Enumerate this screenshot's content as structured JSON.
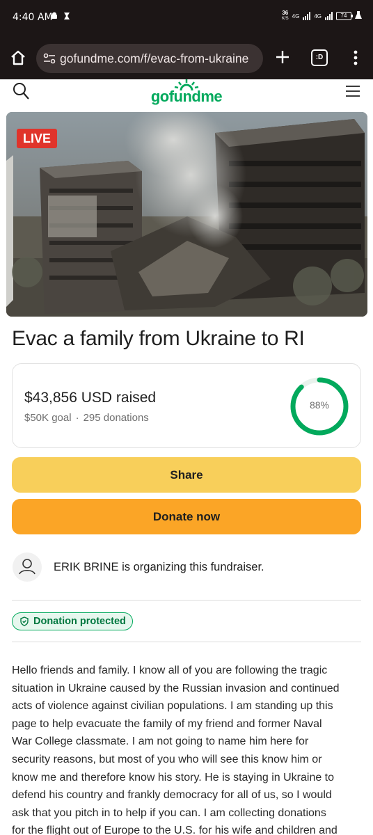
{
  "status_bar": {
    "time": "4:40 AM",
    "net_speed": "36",
    "net_unit": "K/S",
    "sig1": "4G",
    "sig2": "4G",
    "battery": "74"
  },
  "browser": {
    "url": "gofundme.com/f/evac-from-ukraine",
    "tabs_label": ":D"
  },
  "site": {
    "logo_text": "gofundme",
    "brand_color": "#02a95c"
  },
  "hero": {
    "badge": "LIVE"
  },
  "campaign": {
    "title": "Evac a family from Ukraine to RI",
    "raised_text": "$43,856 USD raised",
    "goal_text": "$50K goal",
    "separator": "·",
    "donations_text": "295 donations",
    "progress_percent": 88,
    "progress_label": "88%"
  },
  "actions": {
    "share_label": "Share",
    "donate_label": "Donate now"
  },
  "organizer": {
    "text": "ERIK BRINE is organizing this fundraiser."
  },
  "badge": {
    "protected_label": "Donation protected"
  },
  "story": {
    "lines": [
      "Hello friends and family. I know all of you are following the tragic",
      "situation in Ukraine caused by the Russian invasion and continued",
      "acts of violence against civilian populations. I am standing up this",
      "page to help evacuate the family of my friend and former Naval",
      "War College classmate. I am not going to name him here for",
      "security reasons, but most of you who will see this know him or",
      "know me and therefore know his story. He is staying in Ukraine to",
      "defend his country and frankly democracy for all of us, so I would",
      "ask that you pitch in to help if you can. I am collecting donations",
      "for the flight out of Europe to the U.S. for his wife and children and"
    ]
  }
}
